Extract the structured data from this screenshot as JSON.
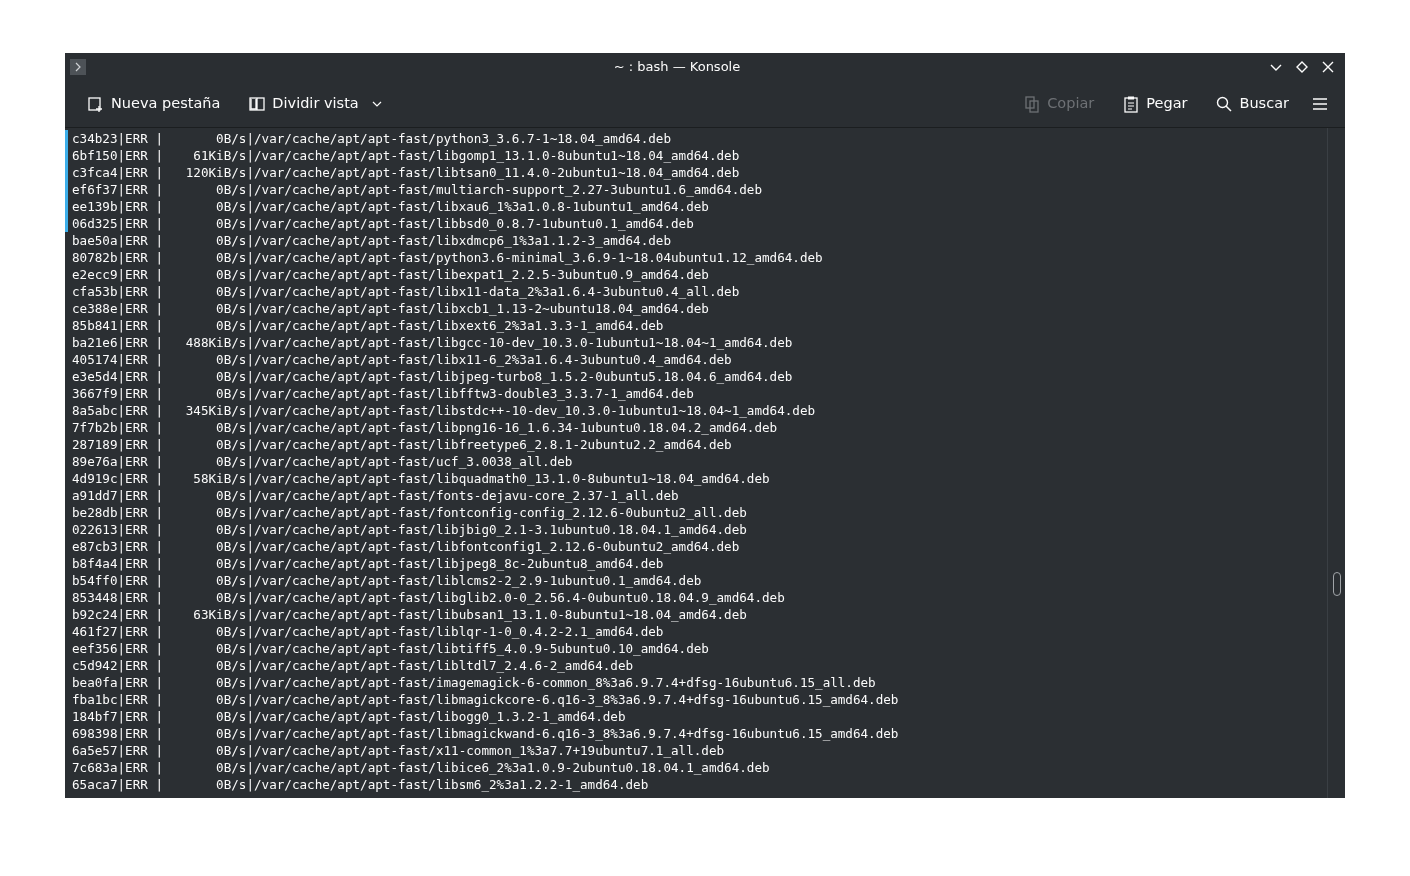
{
  "window": {
    "title": "~ : bash — Konsole"
  },
  "toolbar": {
    "left": [
      {
        "kind": "newtab",
        "label": "Nueva pestaña",
        "disabled": false
      },
      {
        "kind": "split",
        "label": "Dividir vista",
        "disabled": false
      }
    ],
    "right": [
      {
        "kind": "copy",
        "label": "Copiar",
        "disabled": true
      },
      {
        "kind": "paste",
        "label": "Pegar",
        "disabled": false
      },
      {
        "kind": "search",
        "label": "Buscar",
        "disabled": false
      }
    ]
  },
  "terminal": {
    "lines": [
      {
        "text": "c34b23|ERR |       0B/s|/var/cache/apt/apt-fast/python3_3.6.7-1~18.04_amd64.deb",
        "marked": true
      },
      {
        "text": "6bf150|ERR |    61KiB/s|/var/cache/apt/apt-fast/libgomp1_13.1.0-8ubuntu1~18.04_amd64.deb",
        "marked": true
      },
      {
        "text": "c3fca4|ERR |   120KiB/s|/var/cache/apt/apt-fast/libtsan0_11.4.0-2ubuntu1~18.04_amd64.deb",
        "marked": true
      },
      {
        "text": "ef6f37|ERR |       0B/s|/var/cache/apt/apt-fast/multiarch-support_2.27-3ubuntu1.6_amd64.deb",
        "marked": true
      },
      {
        "text": "ee139b|ERR |       0B/s|/var/cache/apt/apt-fast/libxau6_1%3a1.0.8-1ubuntu1_amd64.deb",
        "marked": true
      },
      {
        "text": "06d325|ERR |       0B/s|/var/cache/apt/apt-fast/libbsd0_0.8.7-1ubuntu0.1_amd64.deb",
        "marked": true
      },
      {
        "text": "bae50a|ERR |       0B/s|/var/cache/apt/apt-fast/libxdmcp6_1%3a1.1.2-3_amd64.deb",
        "marked": false
      },
      {
        "text": "80782b|ERR |       0B/s|/var/cache/apt/apt-fast/python3.6-minimal_3.6.9-1~18.04ubuntu1.12_amd64.deb",
        "marked": false
      },
      {
        "text": "e2ecc9|ERR |       0B/s|/var/cache/apt/apt-fast/libexpat1_2.2.5-3ubuntu0.9_amd64.deb",
        "marked": false
      },
      {
        "text": "cfa53b|ERR |       0B/s|/var/cache/apt/apt-fast/libx11-data_2%3a1.6.4-3ubuntu0.4_all.deb",
        "marked": false
      },
      {
        "text": "ce388e|ERR |       0B/s|/var/cache/apt/apt-fast/libxcb1_1.13-2~ubuntu18.04_amd64.deb",
        "marked": false
      },
      {
        "text": "85b841|ERR |       0B/s|/var/cache/apt/apt-fast/libxext6_2%3a1.3.3-1_amd64.deb",
        "marked": false
      },
      {
        "text": "ba21e6|ERR |   488KiB/s|/var/cache/apt/apt-fast/libgcc-10-dev_10.3.0-1ubuntu1~18.04~1_amd64.deb",
        "marked": false
      },
      {
        "text": "405174|ERR |       0B/s|/var/cache/apt/apt-fast/libx11-6_2%3a1.6.4-3ubuntu0.4_amd64.deb",
        "marked": false
      },
      {
        "text": "e3e5d4|ERR |       0B/s|/var/cache/apt/apt-fast/libjpeg-turbo8_1.5.2-0ubuntu5.18.04.6_amd64.deb",
        "marked": false
      },
      {
        "text": "3667f9|ERR |       0B/s|/var/cache/apt/apt-fast/libfftw3-double3_3.3.7-1_amd64.deb",
        "marked": false
      },
      {
        "text": "8a5abc|ERR |   345KiB/s|/var/cache/apt/apt-fast/libstdc++-10-dev_10.3.0-1ubuntu1~18.04~1_amd64.deb",
        "marked": false
      },
      {
        "text": "7f7b2b|ERR |       0B/s|/var/cache/apt/apt-fast/libpng16-16_1.6.34-1ubuntu0.18.04.2_amd64.deb",
        "marked": false
      },
      {
        "text": "287189|ERR |       0B/s|/var/cache/apt/apt-fast/libfreetype6_2.8.1-2ubuntu2.2_amd64.deb",
        "marked": false
      },
      {
        "text": "89e76a|ERR |       0B/s|/var/cache/apt/apt-fast/ucf_3.0038_all.deb",
        "marked": false
      },
      {
        "text": "4d919c|ERR |    58KiB/s|/var/cache/apt/apt-fast/libquadmath0_13.1.0-8ubuntu1~18.04_amd64.deb",
        "marked": false
      },
      {
        "text": "a91dd7|ERR |       0B/s|/var/cache/apt/apt-fast/fonts-dejavu-core_2.37-1_all.deb",
        "marked": false
      },
      {
        "text": "be28db|ERR |       0B/s|/var/cache/apt/apt-fast/fontconfig-config_2.12.6-0ubuntu2_all.deb",
        "marked": false
      },
      {
        "text": "022613|ERR |       0B/s|/var/cache/apt/apt-fast/libjbig0_2.1-3.1ubuntu0.18.04.1_amd64.deb",
        "marked": false
      },
      {
        "text": "e87cb3|ERR |       0B/s|/var/cache/apt/apt-fast/libfontconfig1_2.12.6-0ubuntu2_amd64.deb",
        "marked": false
      },
      {
        "text": "b8f4a4|ERR |       0B/s|/var/cache/apt/apt-fast/libjpeg8_8c-2ubuntu8_amd64.deb",
        "marked": false
      },
      {
        "text": "b54ff0|ERR |       0B/s|/var/cache/apt/apt-fast/liblcms2-2_2.9-1ubuntu0.1_amd64.deb",
        "marked": false
      },
      {
        "text": "853448|ERR |       0B/s|/var/cache/apt/apt-fast/libglib2.0-0_2.56.4-0ubuntu0.18.04.9_amd64.deb",
        "marked": false
      },
      {
        "text": "b92c24|ERR |    63KiB/s|/var/cache/apt/apt-fast/libubsan1_13.1.0-8ubuntu1~18.04_amd64.deb",
        "marked": false
      },
      {
        "text": "461f27|ERR |       0B/s|/var/cache/apt/apt-fast/liblqr-1-0_0.4.2-2.1_amd64.deb",
        "marked": false
      },
      {
        "text": "eef356|ERR |       0B/s|/var/cache/apt/apt-fast/libtiff5_4.0.9-5ubuntu0.10_amd64.deb",
        "marked": false
      },
      {
        "text": "c5d942|ERR |       0B/s|/var/cache/apt/apt-fast/libltdl7_2.4.6-2_amd64.deb",
        "marked": false
      },
      {
        "text": "bea0fa|ERR |       0B/s|/var/cache/apt/apt-fast/imagemagick-6-common_8%3a6.9.7.4+dfsg-16ubuntu6.15_all.deb",
        "marked": false
      },
      {
        "text": "fba1bc|ERR |       0B/s|/var/cache/apt/apt-fast/libmagickcore-6.q16-3_8%3a6.9.7.4+dfsg-16ubuntu6.15_amd64.deb",
        "marked": false
      },
      {
        "text": "184bf7|ERR |       0B/s|/var/cache/apt/apt-fast/libogg0_1.3.2-1_amd64.deb",
        "marked": false
      },
      {
        "text": "698398|ERR |       0B/s|/var/cache/apt/apt-fast/libmagickwand-6.q16-3_8%3a6.9.7.4+dfsg-16ubuntu6.15_amd64.deb",
        "marked": false
      },
      {
        "text": "6a5e57|ERR |       0B/s|/var/cache/apt/apt-fast/x11-common_1%3a7.7+19ubuntu7.1_all.deb",
        "marked": false
      },
      {
        "text": "7c683a|ERR |       0B/s|/var/cache/apt/apt-fast/libice6_2%3a1.0.9-2ubuntu0.18.04.1_amd64.deb",
        "marked": false
      },
      {
        "text": "65aca7|ERR |       0B/s|/var/cache/apt/apt-fast/libsm6_2%3a1.2.2-1_amd64.deb",
        "marked": false
      }
    ]
  }
}
